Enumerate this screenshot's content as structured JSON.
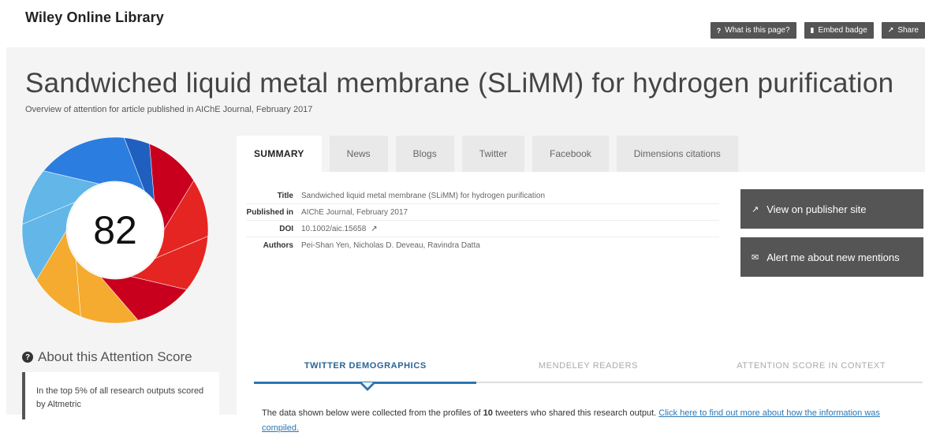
{
  "header": {
    "brand": "Wiley Online Library",
    "buttons": [
      {
        "icon": "?",
        "label": "What is this page?"
      },
      {
        "icon": "📌",
        "label": "Embed badge"
      },
      {
        "icon": "↗",
        "label": "Share"
      }
    ]
  },
  "article": {
    "title": "Sandwiched liquid metal membrane (SLiMM) for hydrogen purification",
    "subtitle": "Overview of attention for article published in AIChE Journal, February 2017"
  },
  "score": {
    "value": "82",
    "colors": [
      "#c8001e",
      "#e52521",
      "#f4ab2f",
      "#62b6e8",
      "#1f5fbf",
      "#2b7de0"
    ]
  },
  "about": {
    "title": "About this Attention Score",
    "box_text": "In the top 5% of all research outputs scored by Altmetric"
  },
  "tabs": [
    "SUMMARY",
    "News",
    "Blogs",
    "Twitter",
    "Facebook",
    "Dimensions citations"
  ],
  "summary": {
    "rows": [
      {
        "label": "Title",
        "value": "Sandwiched liquid metal membrane (SLiMM) for hydrogen purification"
      },
      {
        "label": "Published in",
        "value": "AIChE Journal, February 2017"
      },
      {
        "label": "DOI",
        "value": "10.1002/aic.15658"
      },
      {
        "label": "Authors",
        "value": "Pei-Shan Yen, Nicholas D. Deveau, Ravindra Datta"
      }
    ],
    "buttons": [
      {
        "icon": "external-link-icon",
        "label": "View on publisher site"
      },
      {
        "icon": "envelope-icon",
        "label": "Alert me about new mentions"
      }
    ]
  },
  "subtabs": [
    "TWITTER DEMOGRAPHICS",
    "MENDELEY READERS",
    "ATTENTION SCORE IN CONTEXT"
  ],
  "demographics": {
    "text_before": "The data shown below were collected from the profiles of ",
    "count": "10",
    "text_after": " tweeters who shared this research output. ",
    "link": "Click here to find out more about how the information was compiled."
  }
}
